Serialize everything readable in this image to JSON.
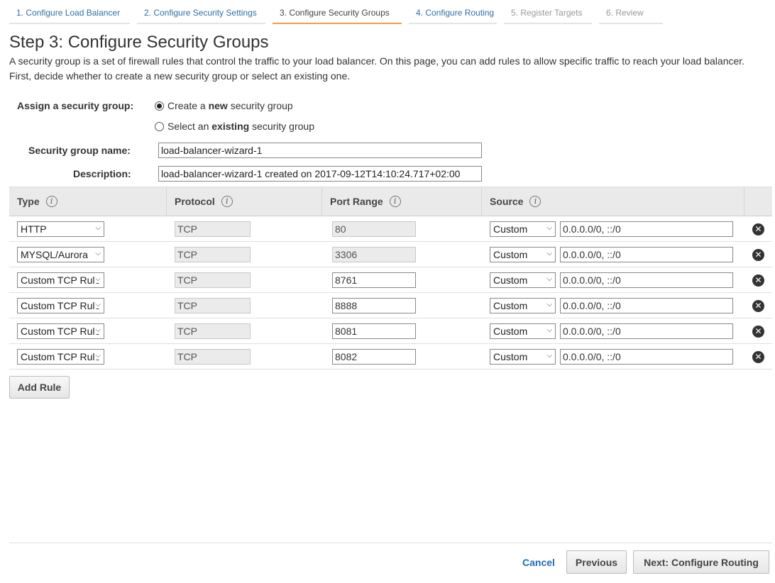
{
  "wizard_tabs": [
    {
      "label": "1. Configure Load Balancer"
    },
    {
      "label": "2. Configure Security Settings"
    },
    {
      "label": "3. Configure Security Groups"
    },
    {
      "label": "4. Configure Routing"
    },
    {
      "label": "5. Register Targets"
    },
    {
      "label": "6. Review"
    }
  ],
  "page_title": "Step 3: Configure Security Groups",
  "intro_text": "A security group is a set of firewall rules that control the traffic to your load balancer. On this page, you can add rules to allow specific traffic to reach your load balancer. First, decide whether to create a new security group or select an existing one.",
  "assign": {
    "label": "Assign a security group:",
    "option_new": {
      "pre": "Create a ",
      "bold": "new",
      "post": " security group",
      "selected": true
    },
    "option_existing": {
      "pre": "Select an ",
      "bold": "existing",
      "post": " security group",
      "selected": false
    }
  },
  "group_name": {
    "label": "Security group name:",
    "value": "load-balancer-wizard-1"
  },
  "description": {
    "label": "Description:",
    "value": "load-balancer-wizard-1 created on 2017-09-12T14:10:24.717+02:00"
  },
  "table": {
    "headers": {
      "type": "Type",
      "protocol": "Protocol",
      "port_range": "Port Range",
      "source": "Source"
    },
    "info_glyph": "i",
    "rows": [
      {
        "type": "HTTP",
        "protocol": "TCP",
        "port": "80",
        "port_readonly": true,
        "source_type": "Custom",
        "source_value": "0.0.0.0/0, ::/0"
      },
      {
        "type": "MYSQL/Aurora",
        "protocol": "TCP",
        "port": "3306",
        "port_readonly": true,
        "source_type": "Custom",
        "source_value": "0.0.0.0/0, ::/0"
      },
      {
        "type": "Custom TCP Rule",
        "protocol": "TCP",
        "port": "8761",
        "port_readonly": false,
        "source_type": "Custom",
        "source_value": "0.0.0.0/0, ::/0"
      },
      {
        "type": "Custom TCP Rule",
        "protocol": "TCP",
        "port": "8888",
        "port_readonly": false,
        "source_type": "Custom",
        "source_value": "0.0.0.0/0, ::/0"
      },
      {
        "type": "Custom TCP Rule",
        "protocol": "TCP",
        "port": "8081",
        "port_readonly": false,
        "source_type": "Custom",
        "source_value": "0.0.0.0/0, ::/0"
      },
      {
        "type": "Custom TCP Rule",
        "protocol": "TCP",
        "port": "8082",
        "port_readonly": false,
        "source_type": "Custom",
        "source_value": "0.0.0.0/0, ::/0"
      }
    ]
  },
  "add_rule_label": "Add Rule",
  "footer": {
    "cancel_label": "Cancel",
    "previous_label": "Previous",
    "next_label": "Next: Configure Routing"
  }
}
